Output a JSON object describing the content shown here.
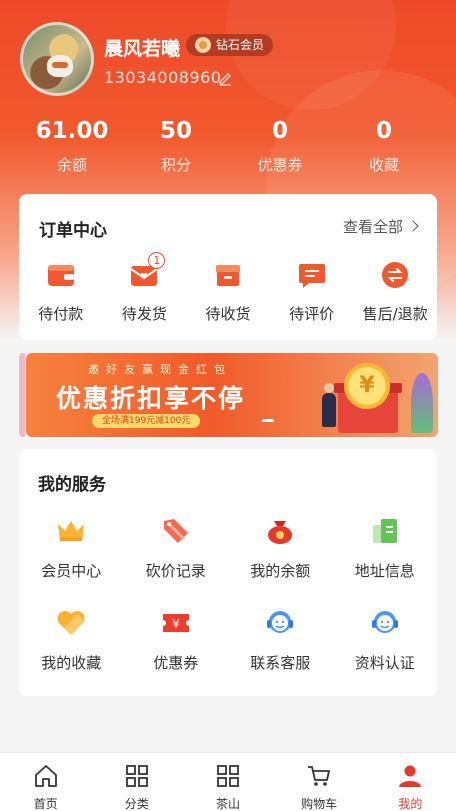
{
  "profile": {
    "name": "晨风若曦",
    "vip_label": "钻石会员",
    "phone": "13034008960"
  },
  "stats": [
    {
      "value": "61.00",
      "label": "余额"
    },
    {
      "value": "50",
      "label": "积分"
    },
    {
      "value": "0",
      "label": "优惠券"
    },
    {
      "value": "0",
      "label": "收藏"
    }
  ],
  "orders": {
    "title": "订单中心",
    "view_all": "查看全部",
    "items": [
      {
        "label": "待付款",
        "icon": "wallet-icon"
      },
      {
        "label": "待发货",
        "icon": "package-icon",
        "badge": "1"
      },
      {
        "label": "待收货",
        "icon": "box-icon"
      },
      {
        "label": "待评价",
        "icon": "comment-icon"
      },
      {
        "label": "售后/退款",
        "icon": "refund-icon"
      }
    ]
  },
  "banner": {
    "invite": "邀好友赢现金红包",
    "headline": "优惠折扣享不停",
    "sub": "全场满199元减100元",
    "coin_symbol": "¥"
  },
  "services": {
    "title": "我的服务",
    "items": [
      {
        "label": "会员中心",
        "icon": "crown-icon"
      },
      {
        "label": "砍价记录",
        "icon": "price-tag-icon"
      },
      {
        "label": "我的余额",
        "icon": "money-bag-icon"
      },
      {
        "label": "地址信息",
        "icon": "address-book-icon"
      },
      {
        "label": "我的收藏",
        "icon": "heart-icon"
      },
      {
        "label": "优惠券",
        "icon": "coupon-icon"
      },
      {
        "label": "联系客服",
        "icon": "customer-service-icon"
      },
      {
        "label": "资料认证",
        "icon": "verify-icon"
      }
    ]
  },
  "tabbar": {
    "items": [
      {
        "label": "首页",
        "icon": "home-icon"
      },
      {
        "label": "分类",
        "icon": "grid-icon"
      },
      {
        "label": "茶山",
        "icon": "grid-icon"
      },
      {
        "label": "购物车",
        "icon": "cart-icon"
      },
      {
        "label": "我的",
        "icon": "user-icon",
        "active": true
      }
    ]
  },
  "colors": {
    "primary": "#ee4a2a",
    "active_tab": "#e8382a"
  }
}
